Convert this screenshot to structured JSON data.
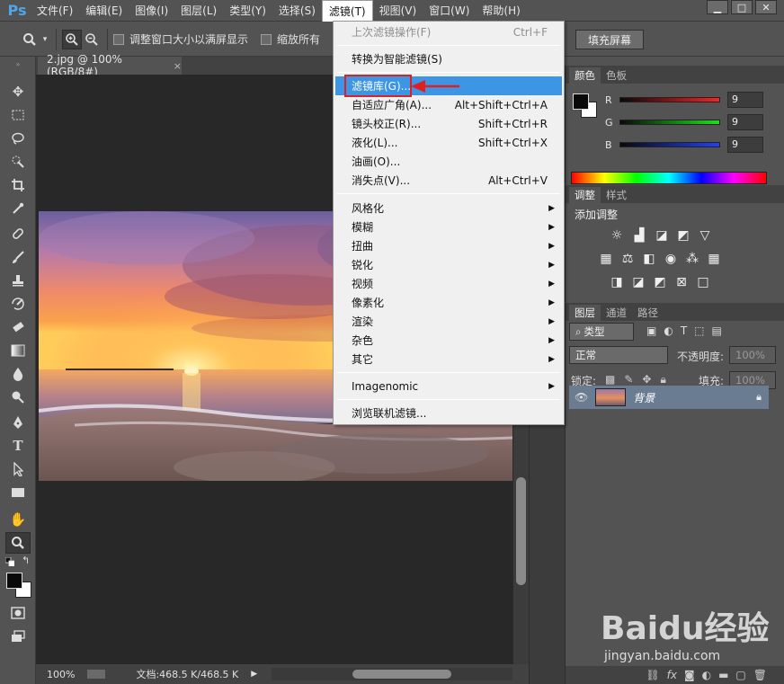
{
  "app": {
    "logo": "Ps"
  },
  "menubar": {
    "items": [
      "文件(F)",
      "编辑(E)",
      "图像(I)",
      "图层(L)",
      "类型(Y)",
      "选择(S)",
      "滤镜(T)",
      "视图(V)",
      "窗口(W)",
      "帮助(H)"
    ],
    "active": "滤镜(T)"
  },
  "window_controls": {
    "minimize": "▁",
    "maximize": "□",
    "close": "✕"
  },
  "options": {
    "resize_windows_label": "调整窗口大小以满屏显示",
    "zoom_all_label": "缩放所有",
    "fill_screen_label": "填充屏幕"
  },
  "document": {
    "tab_title": "2.jpg @ 100%(RGB/8#)",
    "tab_close": "×",
    "zoom": "100%",
    "doc_size": "文档:468.5 K/468.5 K"
  },
  "filter_menu": {
    "last_filter": {
      "label": "上次滤镜操作(F)",
      "shortcut": "Ctrl+F"
    },
    "smart": "转换为智能滤镜(S)",
    "gallery": "滤镜库(G)...",
    "items_a": [
      {
        "label": "自适应广角(A)...",
        "shortcut": "Alt+Shift+Ctrl+A"
      },
      {
        "label": "镜头校正(R)...",
        "shortcut": "Shift+Ctrl+R"
      },
      {
        "label": "液化(L)...",
        "shortcut": "Shift+Ctrl+X"
      },
      {
        "label": "油画(O)...",
        "shortcut": ""
      },
      {
        "label": "消失点(V)...",
        "shortcut": "Alt+Ctrl+V"
      }
    ],
    "submenus": [
      "风格化",
      "模糊",
      "扭曲",
      "锐化",
      "视频",
      "像素化",
      "渲染",
      "杂色",
      "其它"
    ],
    "imagenomic": "Imagenomic",
    "browse_online": "浏览联机滤镜..."
  },
  "color_panel": {
    "tabs": [
      "颜色",
      "色板"
    ],
    "channels": [
      {
        "name": "R",
        "value": "9",
        "color": "#ff3030"
      },
      {
        "name": "G",
        "value": "9",
        "color": "#30d030"
      },
      {
        "name": "B",
        "value": "9",
        "color": "#3060ff"
      }
    ]
  },
  "adjust_panel": {
    "tabs": [
      "调整",
      "样式"
    ],
    "title": "添加调整"
  },
  "layers_panel": {
    "tabs": [
      "图层",
      "通道",
      "路径"
    ],
    "filter_type": "类型",
    "blend_mode": "正常",
    "opacity_label": "不透明度:",
    "opacity_value": "100%",
    "lock_label": "锁定:",
    "fill_label": "填充:",
    "fill_value": "100%",
    "layer_name": "背景"
  },
  "watermark": {
    "brand": "Baidu经验",
    "url": "jingyan.baidu.com"
  }
}
